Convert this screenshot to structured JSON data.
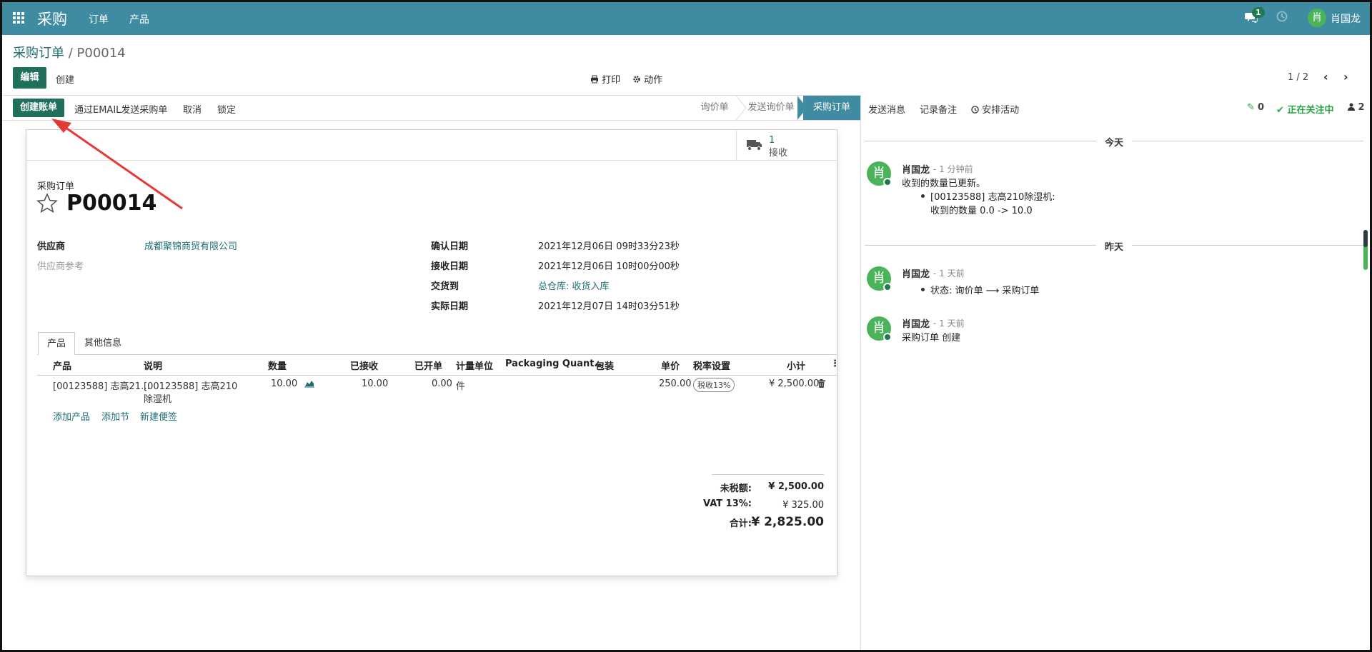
{
  "navbar": {
    "app_name": "采购",
    "menu": [
      "订单",
      "产品"
    ],
    "chat_count": "1",
    "user_initial": "肖",
    "user_name": "肖国龙"
  },
  "breadcrumb": {
    "parent": "采购订单",
    "separator": " / ",
    "current": "P00014"
  },
  "control": {
    "edit": "编辑",
    "create": "创建",
    "print": "打印",
    "action": "动作",
    "pager": "1 / 2"
  },
  "statusbar": {
    "create_bill": "创建账单",
    "send_email": "通过EMAIL发送采购单",
    "cancel": "取消",
    "lock": "锁定",
    "stages": [
      "询价单",
      "发送询价单",
      "采购订单"
    ],
    "active_stage": "采购订单"
  },
  "chatter_top": {
    "send_message": "发送消息",
    "log_note": "记录备注",
    "schedule": "安排活动",
    "attachments": "0",
    "following": "正在关注中",
    "followers": "2"
  },
  "sheet": {
    "receipt_count": "1",
    "receipt_label": "接收",
    "doc_type": "采购订单",
    "doc_name": "P00014",
    "fields": {
      "vendor_label": "供应商",
      "vendor": "成都聚锦商贸有限公司",
      "vendor_ref_label": "供应商参考",
      "confirm_date_label": "确认日期",
      "confirm_date": "2021年12月06日 09时33分23秒",
      "receipt_date_label": "接收日期",
      "receipt_date": "2021年12月06日 10时00分00秒",
      "deliver_to_label": "交货到",
      "deliver_to": "总仓库: 收货入库",
      "effective_date_label": "实际日期",
      "effective_date": "2021年12月07日 14时03分51秒"
    },
    "tabs": [
      "产品",
      "其他信息"
    ],
    "columns": [
      "产品",
      "说明",
      "数量",
      "已接收",
      "已开单",
      "计量单位",
      "Packaging Quant…",
      "包装",
      "单价",
      "税率设置",
      "小计"
    ],
    "line": {
      "product": "[00123588] 志高21…",
      "desc1": "[00123588] 志高210",
      "desc2": "除湿机",
      "qty": "10.00",
      "received": "10.00",
      "billed": "0.00",
      "uom": "件",
      "price": "250.00",
      "tax": "税收13%",
      "subtotal": "¥ 2,500.00"
    },
    "add_links": [
      "添加产品",
      "添加节",
      "新建便签"
    ],
    "totals": {
      "untaxed_label": "未税额:",
      "untaxed": "¥ 2,500.00",
      "vat_label": "VAT 13%:",
      "vat": "¥ 325.00",
      "total_label": "合计:",
      "total": "¥ 2,825.00"
    }
  },
  "chatter": {
    "today": "今天",
    "yesterday": "昨天",
    "messages": [
      {
        "initial": "肖",
        "author": "肖国龙",
        "time": "- 1 分钟前",
        "body": "收到的数量已更新。",
        "bullet1": "[00123588] 志高210除湿机:",
        "bullet2": "收到的数量 0.0 -> 10.0"
      },
      {
        "initial": "肖",
        "author": "肖国龙",
        "time": "- 1 天前",
        "bullet": "状态: 询价单 ⟶ 采购订单"
      },
      {
        "initial": "肖",
        "author": "肖国龙",
        "time": "- 1 天前",
        "body": "采购订单 创建"
      }
    ]
  },
  "colors": {
    "navbar": "#3f8ba1",
    "primary": "#1f6f5c",
    "link": "#1d6e73",
    "annotation_arrow": "#e53935"
  }
}
